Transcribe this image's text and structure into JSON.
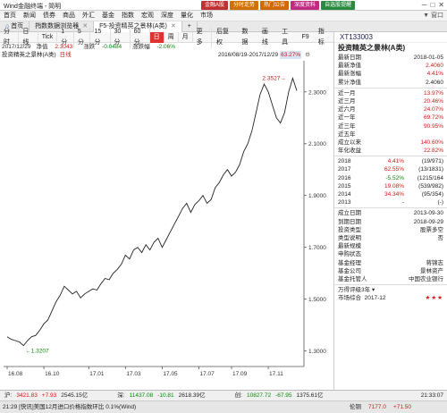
{
  "app": {
    "title": "Wind金融终端 - 简明",
    "pills": [
      {
        "label": "金融A股",
        "color": "#c03030"
      },
      {
        "label": "分时走势",
        "color": "#d07000"
      },
      {
        "label": "热门公告",
        "color": "#d06a00"
      },
      {
        "label": "深度资料",
        "color": "#c02a80"
      },
      {
        "label": "自选股提醒",
        "color": "#2a8a40"
      }
    ],
    "window_buttons": [
      "─",
      "□",
      "✕"
    ]
  },
  "menu": {
    "items": [
      "首页",
      "新闻",
      "债券",
      "商品",
      "外汇",
      "基金",
      "指数",
      "宏观",
      "深度",
      "量化",
      "市场"
    ],
    "right": "▼ 窗口"
  },
  "tabs": [
    {
      "label": "首页",
      "active": false
    },
    {
      "label": "指数数据浏览器",
      "active": false
    },
    {
      "label": "F5-投资精英之景林(A类)",
      "active": true
    },
    {
      "label": "+",
      "active": false
    }
  ],
  "chart_toolbar": {
    "left": [
      "分时",
      "日线",
      "Tick",
      "1分",
      "5分",
      "15分",
      "30分",
      "60分",
      "日",
      "周",
      "月",
      "更多"
    ],
    "right": [
      "后复权",
      "数据",
      "画线",
      "工具",
      "F9",
      "指标"
    ]
  },
  "info": {
    "date": "2017/12/29",
    "nav_label": "净值",
    "nav": "2.3043",
    "chg_label": "涨跌",
    "chg": "-0.0484",
    "pct_label": "涨跌幅",
    "pct": "-2.06%",
    "fund_line": "投资精英之景林(A类)",
    "period_label": "日线",
    "range": "2016/08/19-2017/12/29",
    "range_pct": "63.27%"
  },
  "chart_data": {
    "type": "line",
    "x": [
      "2016-08-19",
      "2016-08-26",
      "2016-09-02",
      "2016-09-09",
      "2016-09-16",
      "2016-09-23",
      "2016-09-30",
      "2016-10-07",
      "2016-10-14",
      "2016-10-21",
      "2016-10-28",
      "2016-11-04",
      "2016-11-11",
      "2016-11-18",
      "2016-11-25",
      "2016-12-02",
      "2016-12-09",
      "2016-12-16",
      "2016-12-23",
      "2016-12-30",
      "2017-01-06",
      "2017-01-13",
      "2017-01-20",
      "2017-01-27",
      "2017-02-03",
      "2017-02-10",
      "2017-02-17",
      "2017-02-24",
      "2017-03-03",
      "2017-03-10",
      "2017-03-17",
      "2017-03-24",
      "2017-03-31",
      "2017-04-07",
      "2017-04-14",
      "2017-04-21",
      "2017-04-28",
      "2017-05-05",
      "2017-05-12",
      "2017-05-19",
      "2017-05-26",
      "2017-06-02",
      "2017-06-09",
      "2017-06-16",
      "2017-06-23",
      "2017-06-30",
      "2017-07-07",
      "2017-07-14",
      "2017-07-21",
      "2017-07-28",
      "2017-08-04",
      "2017-08-11",
      "2017-08-18",
      "2017-08-25",
      "2017-09-01",
      "2017-09-08",
      "2017-09-15",
      "2017-09-22",
      "2017-09-29",
      "2017-10-06",
      "2017-10-13",
      "2017-10-20",
      "2017-10-27",
      "2017-11-03",
      "2017-11-10",
      "2017-11-17",
      "2017-11-24",
      "2017-12-01",
      "2017-12-08",
      "2017-12-15",
      "2017-12-22",
      "2017-12-29"
    ],
    "values": [
      1.355,
      1.345,
      1.34,
      1.335,
      1.3207,
      1.34,
      1.355,
      1.36,
      1.38,
      1.405,
      1.42,
      1.455,
      1.49,
      1.515,
      1.55,
      1.535,
      1.52,
      1.53,
      1.505,
      1.52,
      1.53,
      1.54,
      1.535,
      1.56,
      1.58,
      1.575,
      1.6,
      1.615,
      1.635,
      1.67,
      1.655,
      1.69,
      1.7,
      1.68,
      1.71,
      1.69,
      1.72,
      1.735,
      1.7,
      1.73,
      1.76,
      1.79,
      1.82,
      1.85,
      1.87,
      1.835,
      1.865,
      1.88,
      1.9,
      1.87,
      1.885,
      1.93,
      1.95,
      1.98,
      2.0,
      1.975,
      1.99,
      2.02,
      2.07,
      2.1,
      2.15,
      2.22,
      2.29,
      2.33,
      2.3,
      2.25,
      2.2,
      2.18,
      2.22,
      2.3,
      2.3527,
      2.3043
    ],
    "xticks": [
      {
        "label": "16.08",
        "i": 0
      },
      {
        "label": "16.10",
        "i": 9
      },
      {
        "label": "17.01",
        "i": 20
      },
      {
        "label": "17.03",
        "i": 29
      },
      {
        "label": "17.05",
        "i": 38
      },
      {
        "label": "17.07",
        "i": 47
      },
      {
        "label": "17.09",
        "i": 55
      },
      {
        "label": "17.11",
        "i": 64
      }
    ],
    "yticks": [
      1.3,
      1.5,
      1.7,
      1.9,
      2.1,
      2.3
    ],
    "ytick_labels": [
      "1.3000",
      "1.5000",
      "1.7000",
      "1.9000",
      "2.1000",
      "2.3000"
    ],
    "ylim": [
      1.24,
      2.42
    ],
    "annotations": {
      "low": "1.3207",
      "high": "2.3527"
    },
    "grid": false
  },
  "panel": {
    "code": "XT133003",
    "name": "投资精英之景林(A类)",
    "basics": [
      {
        "k": "最新日期",
        "v": "2018-01-05",
        "cls": ""
      },
      {
        "k": "最新净值",
        "v": "2.4060",
        "cls": "red"
      },
      {
        "k": "最新涨幅",
        "v": "4.41%",
        "cls": "red"
      },
      {
        "k": "累计净值",
        "v": "2.4060",
        "cls": ""
      }
    ],
    "returns": [
      {
        "k": "近一月",
        "v": "13.97%"
      },
      {
        "k": "近三月",
        "v": "20.46%"
      },
      {
        "k": "近六月",
        "v": "24.07%"
      },
      {
        "k": "近一年",
        "v": "69.72%"
      },
      {
        "k": "近三年",
        "v": "90.95%"
      },
      {
        "k": "近五年",
        "v": ""
      },
      {
        "k": "成立以来",
        "v": "140.60%"
      },
      {
        "k": "年化收益",
        "v": "22.82%"
      }
    ],
    "years": [
      {
        "y": "2018",
        "p": "4.41%",
        "cls": "red",
        "r": "(19/971)"
      },
      {
        "y": "2017",
        "p": "62.55%",
        "cls": "red",
        "r": "(13/1831)"
      },
      {
        "y": "2016",
        "p": "-5.52%",
        "cls": "green",
        "r": "(1215/164"
      },
      {
        "y": "2015",
        "p": "19.08%",
        "cls": "red",
        "r": "(539/982)"
      },
      {
        "y": "2014",
        "p": "34.34%",
        "cls": "red",
        "r": "(95/354)"
      },
      {
        "y": "2013",
        "p": "-",
        "cls": "",
        "r": "(-)"
      }
    ],
    "details": [
      {
        "k": "成立日期",
        "v": "2013-09-30"
      },
      {
        "k": "到期日期",
        "v": "2018-09-29"
      },
      {
        "k": "投资类型",
        "v": "股票多空"
      },
      {
        "k": "类型说明",
        "v": "否"
      },
      {
        "k": "最新规模",
        "v": ""
      },
      {
        "k": "申购状态",
        "v": ""
      },
      {
        "k": "基金经理",
        "v": "蒋锦志"
      },
      {
        "k": "基金公司",
        "v": "景林资产"
      },
      {
        "k": "基金托管人",
        "v": "中国农业银行"
      }
    ],
    "rating_label": "万得评级",
    "rating_period": "3年",
    "market_label": "市场综合",
    "market_date": "2017-12",
    "stars": "★★★"
  },
  "status": [
    {
      "name": "沪:",
      "a": "3421.83",
      "b": "+7.93",
      "c": "2545.15亿"
    },
    {
      "name": "深:",
      "a": "11437.08",
      "b": "-10.81",
      "c": "2618.39亿"
    },
    {
      "name": "创:",
      "a": "10827.72",
      "b": "-67.95",
      "c": "1375.61亿"
    }
  ],
  "clock": "21:33:07",
  "news": {
    "text": "21:29 [快讯]美国12月进口价格指数环比 0.1%(Wind)",
    "ticker_label": "伦铜",
    "ticker_value": "7177.0",
    "ticker_change": "+71.50"
  }
}
